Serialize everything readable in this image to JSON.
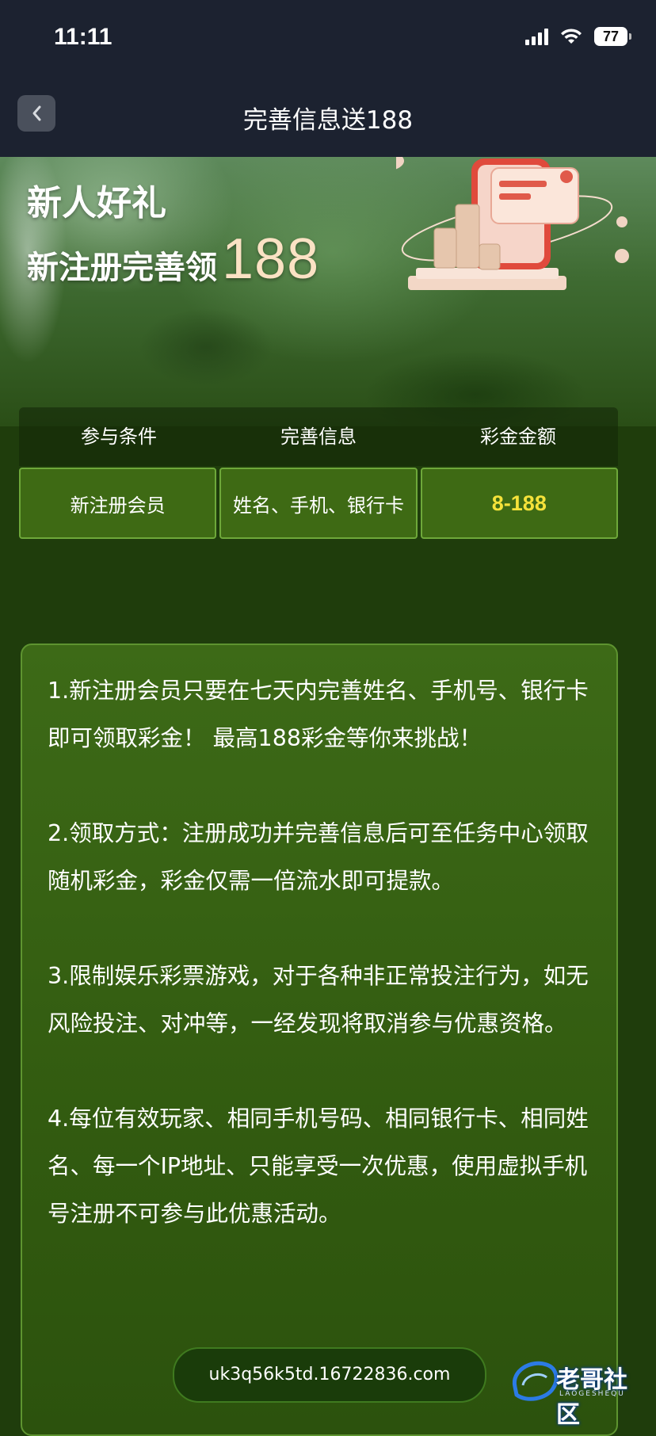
{
  "status_bar": {
    "time": "11:11",
    "battery": "77"
  },
  "nav": {
    "title": "完善信息送188"
  },
  "hero": {
    "title": "新人好礼",
    "subtitle_text": "新注册完善领",
    "subtitle_amount": "188"
  },
  "table": {
    "headers": [
      "参与条件",
      "完善信息",
      "彩金金额"
    ],
    "row": [
      "新注册会员",
      "姓名、手机、银行卡",
      "8-188"
    ]
  },
  "rules": [
    "1.新注册会员只要在七天内完善姓名、手机号、银行卡即可领取彩金！ 最高188彩金等你来挑战！",
    "2.领取方式：注册成功并完善信息后可至任务中心领取随机彩金，彩金仅需一倍流水即可提款。",
    "3.限制娱乐彩票游戏，对于各种非正常投注行为，如无风险投注、对冲等，一经发现将取消参与优惠资格。",
    "4.每位有效玩家、相同手机号码、相同银行卡、相同姓名、每一个IP地址、只能享受一次优惠，使用虚拟手机号注册不可参与此优惠活动。"
  ],
  "footer": {
    "domain": "uk3q56k5td.16722836.com"
  },
  "watermark": {
    "text": "老哥社区",
    "sub": "LAOGESHEQU"
  },
  "colors": {
    "accent_amount": "#f5e23a",
    "bar_bg": "#1c2230"
  }
}
